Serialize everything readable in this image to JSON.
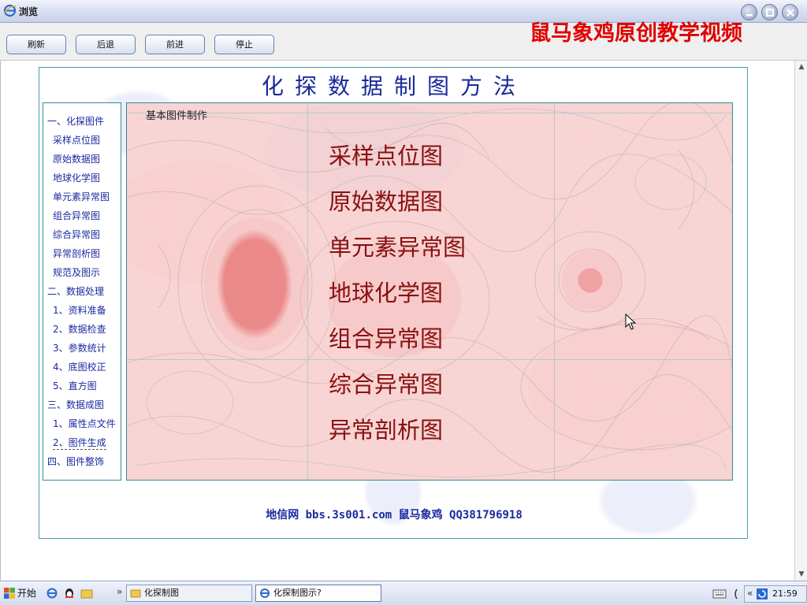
{
  "window": {
    "title": "浏览",
    "watermark": "鼠马象鸡原创教学视频"
  },
  "toolbar": {
    "refresh": "刷新",
    "back": "后退",
    "forward": "前进",
    "stop": "停止"
  },
  "page": {
    "title": "化探数据制图方法",
    "pane_heading": "基本图件制作",
    "footer": "地信网 bbs.3s001.com 鼠马象鸡 QQ381796918"
  },
  "sidebar": {
    "items": [
      "一、化探图件",
      "采样点位图",
      "原始数据图",
      "地球化学图",
      "单元素异常图",
      "组合异常图",
      "综合异常图",
      "异常剖析图",
      "规范及图示",
      "二、数据处理",
      "1、资料准备",
      "2、数据检查",
      "3、参数统计",
      "4、底图校正",
      "5、直方图",
      "三、数据成图",
      "1、属性点文件",
      "2、图件生成",
      "四、图件整饰"
    ]
  },
  "main": {
    "items": [
      "采样点位图",
      "原始数据图",
      "单元素异常图",
      "地球化学图",
      "组合异常图",
      "综合异常图",
      "异常剖析图"
    ]
  },
  "taskbar": {
    "start": "开始",
    "tasks": [
      "化探制图",
      "化探制图示?"
    ],
    "clock": "21:59",
    "expand": "»"
  }
}
